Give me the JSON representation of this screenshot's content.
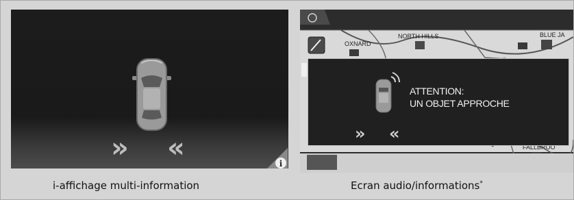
{
  "left_panel": {
    "caption": "i-affichage multi-information",
    "info_icon": "info-icon",
    "arrows": [
      "»",
      "«"
    ]
  },
  "right_panel": {
    "caption": "Ecran audio/informations",
    "caption_mark": "*",
    "map_labels": [
      "OXNARD",
      "NORTH HILLS",
      "BLUE JA",
      "FALLBROO"
    ],
    "warning_line1": "ATTENTION:",
    "warning_line2": "UN OBJET APPROCHE",
    "arrows": [
      "»",
      "«"
    ]
  }
}
